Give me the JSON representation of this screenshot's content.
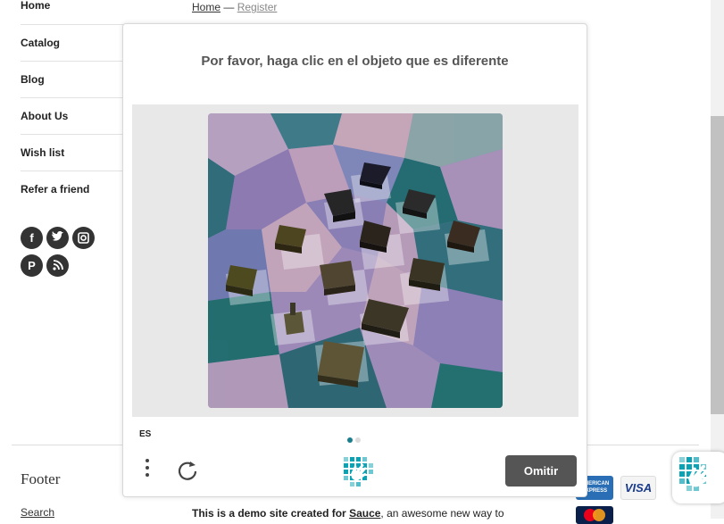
{
  "sidebar": {
    "items": [
      {
        "label": "Home"
      },
      {
        "label": "Catalog"
      },
      {
        "label": "Blog"
      },
      {
        "label": "About Us"
      },
      {
        "label": "Wish list"
      },
      {
        "label": "Refer a friend"
      }
    ],
    "social": [
      "facebook-icon",
      "twitter-icon",
      "instagram-icon",
      "pinterest-icon",
      "rss-icon"
    ]
  },
  "breadcrumb": {
    "home": "Home",
    "separator": "—",
    "current": "Register"
  },
  "footer": {
    "title": "Footer",
    "search_link": "Search",
    "demo_prefix": "This is a demo site created for ",
    "demo_link": "Sauce",
    "demo_suffix": ", an awesome new way to",
    "payments": [
      "AMERICAN EXPRESS",
      "VISA",
      "MasterCard"
    ]
  },
  "captcha": {
    "prompt": "Por favor, haga clic en el objeto que es diferente",
    "language": "ES",
    "skip_label": "Omitir",
    "page_indicator": {
      "current": 1,
      "total": 2
    },
    "colors": {
      "accent": "#0a8b95",
      "button": "#555555",
      "panel": "#e8e8e8"
    }
  }
}
